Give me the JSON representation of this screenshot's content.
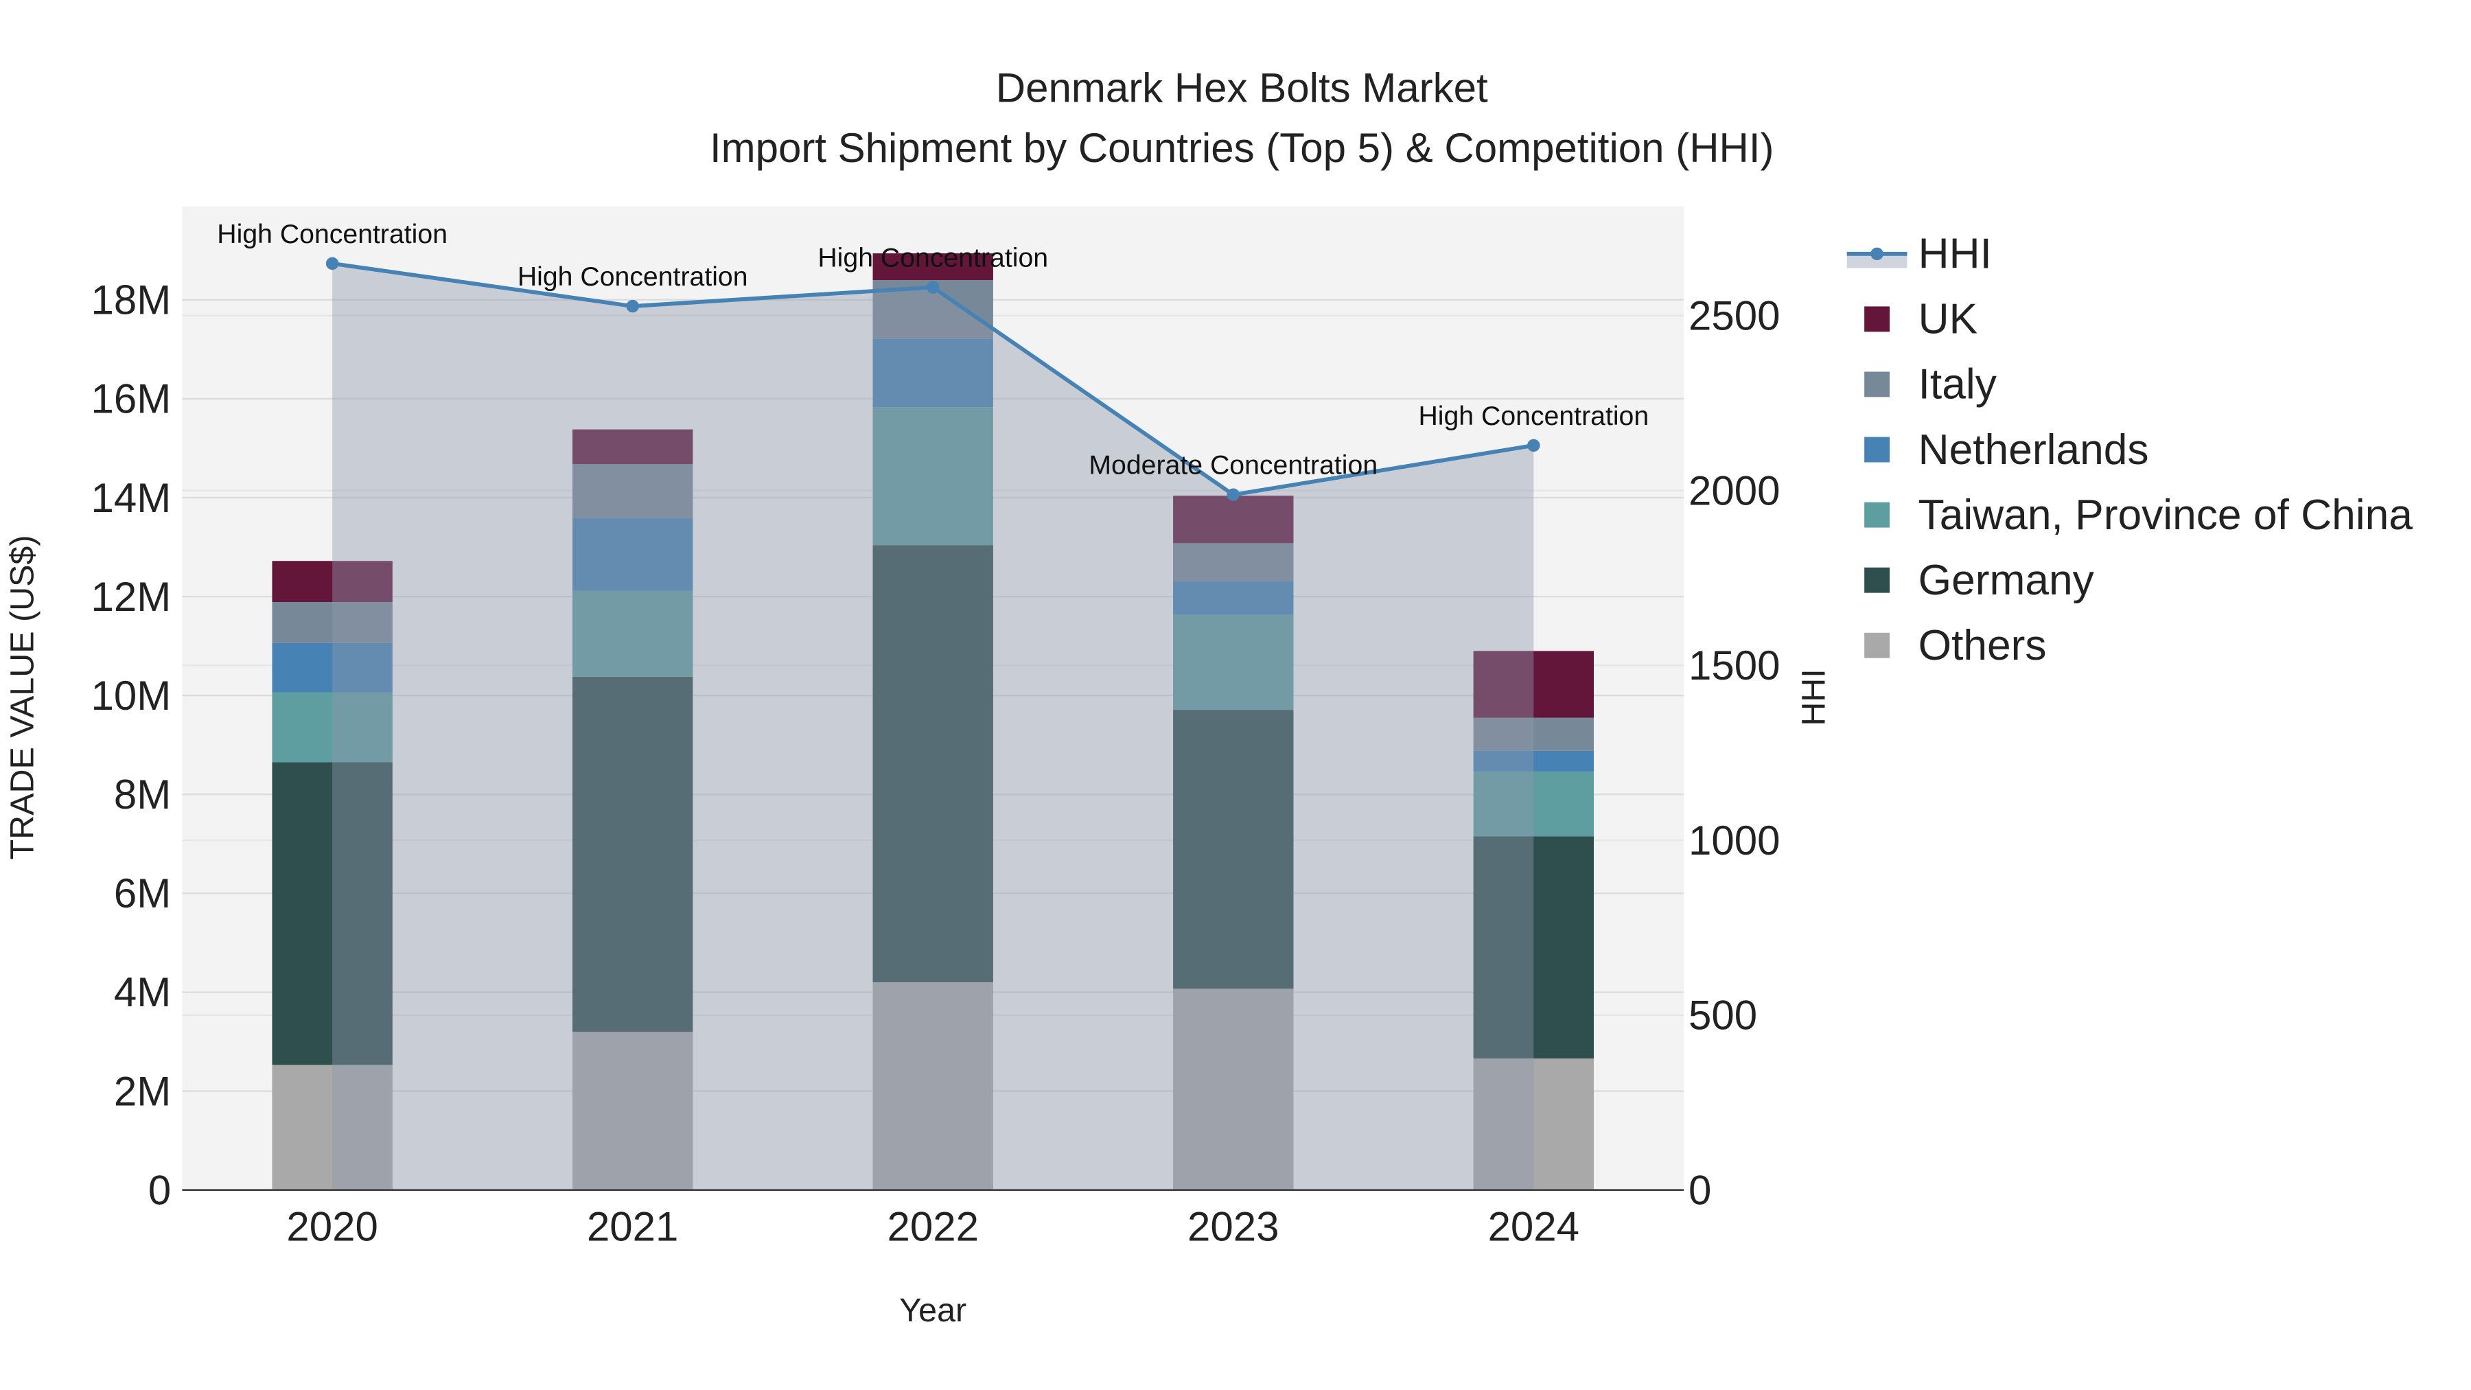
{
  "chart_data": {
    "type": "bar",
    "stacked": true,
    "title": "Denmark Hex Bolts Market",
    "subtitle": "Import Shipment by Countries (Top 5) & Competition (HHI)",
    "xlabel": "Year",
    "ylabel": "TRADE VALUE (US$)",
    "y2label": "HHI",
    "categories": [
      "2020",
      "2021",
      "2022",
      "2023",
      "2024"
    ],
    "ylim": [
      0,
      19.5
    ],
    "y_ticks": [
      0,
      2,
      4,
      6,
      8,
      10,
      12,
      14,
      16,
      18
    ],
    "y_tick_labels": [
      "0",
      "2M",
      "4M",
      "6M",
      "8M",
      "10M",
      "12M",
      "14M",
      "16M",
      "18M"
    ],
    "y2lim": [
      0,
      2812
    ],
    "y2_ticks": [
      0,
      500,
      1000,
      1500,
      2000,
      2500
    ],
    "y2_tick_labels": [
      "0",
      "500",
      "1000",
      "1500",
      "2000",
      "2500"
    ],
    "units": "million US$",
    "series": [
      {
        "name": "Others",
        "color": "#a9a9a9",
        "values": [
          2.53,
          3.2,
          4.2,
          4.07,
          2.66
        ]
      },
      {
        "name": "Germany",
        "color": "#2f4f4f",
        "values": [
          6.12,
          7.18,
          8.84,
          5.64,
          4.49
        ]
      },
      {
        "name": "Taiwan, Province of China",
        "color": "#5f9ea0",
        "values": [
          1.41,
          1.74,
          2.79,
          1.92,
          1.31
        ]
      },
      {
        "name": "Netherlands",
        "color": "#4682b4",
        "values": [
          1.0,
          1.47,
          1.38,
          0.68,
          0.42
        ]
      },
      {
        "name": "Italy",
        "color": "#778899",
        "values": [
          0.83,
          1.09,
          1.19,
          0.77,
          0.67
        ]
      },
      {
        "name": "UK",
        "color": "#63153a",
        "values": [
          0.83,
          0.7,
          0.54,
          0.96,
          1.35
        ]
      }
    ],
    "hhi": {
      "name": "HHI",
      "color": "#4682b4",
      "values": [
        2649,
        2527,
        2581,
        1988,
        2129
      ],
      "annotations": [
        "High Concentration",
        "High Concentration",
        "High Concentration",
        "Moderate Concentration",
        "High Concentration"
      ]
    },
    "legend_order": [
      "HHI",
      "UK",
      "Italy",
      "Netherlands",
      "Taiwan, Province of China",
      "Germany",
      "Others"
    ],
    "legend_placement": "right",
    "grid": true
  }
}
